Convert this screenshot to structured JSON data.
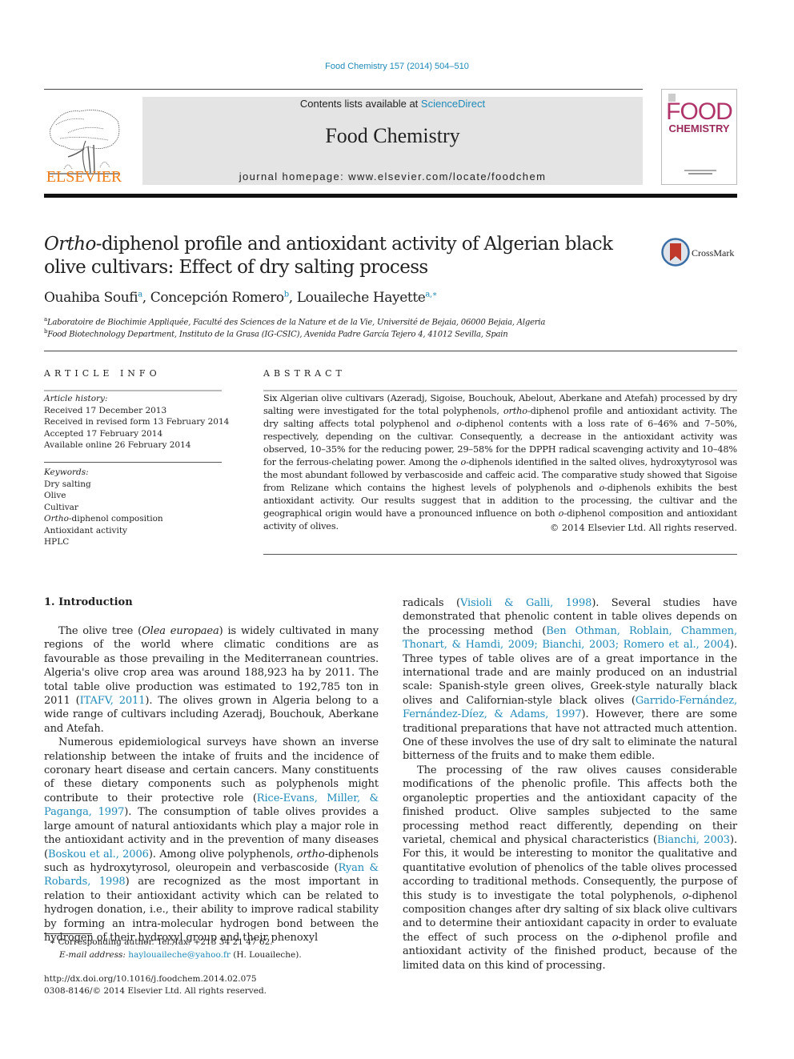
{
  "header": {
    "citation": "Food Chemistry 157 (2014) 504–510",
    "contents_prefix": "Contents lists available at ",
    "contents_link": "ScienceDirect",
    "journal_name": "Food Chemistry",
    "homepage": "journal homepage: www.elsevier.com/locate/foodchem",
    "publisher_logo_text": "ELSEVIER",
    "cover": {
      "line1": "FOOD",
      "line2": "CHEMISTRY"
    },
    "colors": {
      "link": "#1f8ab8",
      "elsevier_orange": "#f07f1b",
      "cover_magenta": "#b0336a",
      "banner_bg": "#e4e4e4"
    }
  },
  "article": {
    "title_italic": "Ortho",
    "title_rest": "-diphenol profile and antioxidant activity of Algerian black olive cultivars: Effect of dry salting process",
    "crossmark_label": "CrossMark",
    "authors": [
      {
        "name": "Ouahiba Soufi",
        "sup": "a"
      },
      {
        "name": "Concepción Romero",
        "sup": "b"
      },
      {
        "name": "Louaileche Hayette",
        "sup": "a,∗"
      }
    ],
    "affiliations": [
      {
        "sup": "a",
        "text": "Laboratoire de Biochimie Appliquée, Faculté des Sciences de la Nature et de la Vie, Université de Bejaia, 06000 Bejaia, Algeria"
      },
      {
        "sup": "b",
        "text": "Food Biotechnology Department, Instituto de la Grasa (IG-CSIC), Avenida Padre García Tejero 4, 41012 Sevilla, Spain"
      }
    ]
  },
  "article_info": {
    "heading": "ARTICLE INFO",
    "history_label": "Article history:",
    "history": [
      "Received 17 December 2013",
      "Received in revised form 13 February 2014",
      "Accepted 17 February 2014",
      "Available online 26 February 2014"
    ],
    "keywords_label": "Keywords:",
    "keywords": [
      {
        "italic": "",
        "text": "Dry salting"
      },
      {
        "italic": "",
        "text": "Olive"
      },
      {
        "italic": "",
        "text": "Cultivar"
      },
      {
        "italic": "Ortho",
        "text": "-diphenol composition"
      },
      {
        "italic": "",
        "text": "Antioxidant activity"
      },
      {
        "italic": "",
        "text": "HPLC"
      }
    ]
  },
  "abstract": {
    "heading": "ABSTRACT",
    "segments": [
      {
        "t": "Six Algerian olive cultivars (Azeradj, Sigoise, Bouchouk, Abelout, Aberkane and Atefah) processed by dry salting were investigated for the total polyphenols, "
      },
      {
        "t": "ortho",
        "i": true
      },
      {
        "t": "-diphenol profile and antioxidant activity. The dry salting affects total polyphenol and "
      },
      {
        "t": "o",
        "i": true
      },
      {
        "t": "-diphenol contents with a loss rate of 6–46% and 7–50%, respectively, depending on the cultivar. Consequently, a decrease in the antioxidant activity was observed, 10–35% for the reducing power, 29–58% for the DPPH radical scavenging activity and 10–48% for the ferrous-chelating power. Among the "
      },
      {
        "t": "o",
        "i": true
      },
      {
        "t": "-diphenols identified in the salted olives, hydroxytyrosol was the most abundant followed by verbascoside and caffeic acid. The comparative study showed that Sigoise from Relizane which contains the highest levels of polyphenols and "
      },
      {
        "t": "o",
        "i": true
      },
      {
        "t": "-diphenols exhibits the best antioxidant activity. Our results suggest that in addition to the processing, the cultivar and the geographical origin would have a pronounced influence on both "
      },
      {
        "t": "o",
        "i": true
      },
      {
        "t": "-diphenol composition and antioxidant activity of olives."
      }
    ],
    "copyright": "© 2014 Elsevier Ltd. All rights reserved."
  },
  "introduction": {
    "heading": "1. Introduction",
    "left_paragraphs": [
      [
        {
          "t": "The olive tree ("
        },
        {
          "t": "Olea europaea",
          "i": true
        },
        {
          "t": ") is widely cultivated in many regions of the world where climatic conditions are as favourable as those prevailing in the Mediterranean countries. Algeria's olive crop area was around 188,923 ha by 2011. The total table olive production was estimated to 192,785 ton in 2011 ("
        },
        {
          "t": "ITAFV, 2011",
          "l": true
        },
        {
          "t": "). The olives grown in Algeria belong to a wide range of cultivars including Azeradj, Bouchouk, Aberkane and Atefah."
        }
      ],
      [
        {
          "t": "Numerous epidemiological surveys have shown an inverse relationship between the intake of fruits and the incidence of coronary heart disease and certain cancers. Many constituents of these dietary components such as polyphenols might contribute to their protective role ("
        },
        {
          "t": "Rice-Evans, Miller, & Paganga, 1997",
          "l": true
        },
        {
          "t": "). The consumption of table olives provides a large amount of natural antioxidants which play a major role in the antioxidant activity and in the prevention of many diseases ("
        },
        {
          "t": "Boskou et al., 2006",
          "l": true
        },
        {
          "t": "). Among olive polyphenols, "
        },
        {
          "t": "ortho",
          "i": true
        },
        {
          "t": "-diphenols such as hydroxytyrosol, oleuropein and verbascoside ("
        },
        {
          "t": "Ryan & Robards, 1998",
          "l": true
        },
        {
          "t": ") are recognized as the most important in relation to their antioxidant activity which can be related to hydrogen donation, i.e., their ability to improve radical stability by forming an intra-molecular hydrogen bond between the hydrogen of their hydroxyl group and their phenoxyl"
        }
      ]
    ],
    "right_paragraphs": [
      [
        {
          "t": "radicals ("
        },
        {
          "t": "Visioli & Galli, 1998",
          "l": true
        },
        {
          "t": "). Several studies have demonstrated that phenolic content in table olives depends on the processing method ("
        },
        {
          "t": "Ben Othman, Roblain, Chammen, Thonart, & Hamdi, 2009; Bianchi, 2003; Romero et al., 2004",
          "l": true
        },
        {
          "t": "). Three types of table olives are of a great importance in the international trade and are mainly produced on an industrial scale: Spanish-style green olives, Greek-style naturally black olives and Californian-style black olives ("
        },
        {
          "t": "Garrido-Fernández, Fernández-Díez, & Adams, 1997",
          "l": true
        },
        {
          "t": "). However, there are some traditional preparations that have not attracted much attention. One of these involves the use of dry salt to eliminate the natural bitterness of the fruits and to make them edible."
        }
      ],
      [
        {
          "t": "The processing of the raw olives causes considerable modifications of the phenolic profile. This affects both the organoleptic properties and the antioxidant capacity of the finished product. Olive samples subjected to the same processing method react differently, depending on their varietal, chemical and physical characteristics ("
        },
        {
          "t": "Bianchi, 2003",
          "l": true
        },
        {
          "t": "). For this, it would be interesting to monitor the qualitative and quantitative evolution of phenolics of the table olives processed according to traditional methods. Consequently, the purpose of this study is to investigate the total polyphenols, "
        },
        {
          "t": "o",
          "i": true
        },
        {
          "t": "-diphenol composition changes after dry salting of six black olive cultivars and to determine their antioxidant capacity in order to evaluate the effect of such process on the "
        },
        {
          "t": "o",
          "i": true
        },
        {
          "t": "-diphenol profile and antioxidant activity of the finished product, because of the limited data on this kind of processing."
        }
      ]
    ]
  },
  "footnotes": {
    "corresponding": "∗ Corresponding author. Tel./fax: +213 34 21 47 62.",
    "email_label": "E-mail address: ",
    "email": "haylouaileche@yahoo.fr",
    "email_suffix": " (H. Louaileche).",
    "doi": "http://dx.doi.org/10.1016/j.foodchem.2014.02.075",
    "issn": "0308-8146/© 2014 Elsevier Ltd. All rights reserved."
  }
}
